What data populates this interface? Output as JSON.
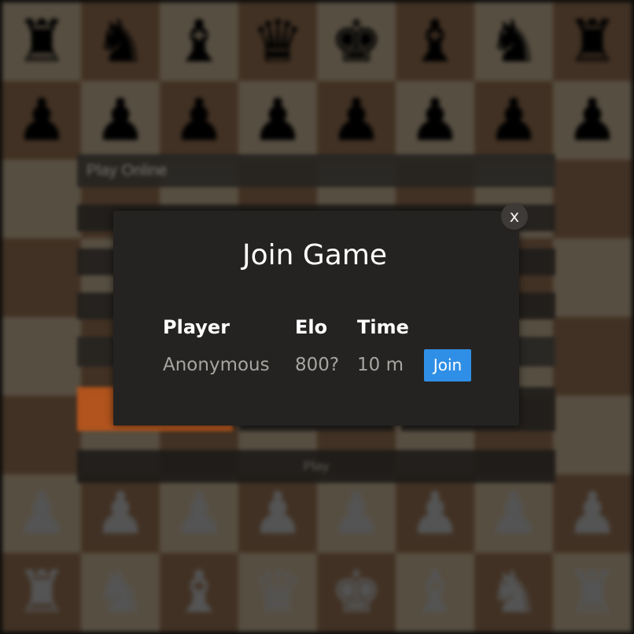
{
  "board": {
    "ranks": [
      [
        "br",
        "bn",
        "bb",
        "bq",
        "bk",
        "bb",
        "bn",
        "br"
      ],
      [
        "bp",
        "bp",
        "bp",
        "bp",
        "bp",
        "bp",
        "bp",
        "bp"
      ],
      [
        "",
        "",
        "",
        "",
        "",
        "",
        "",
        ""
      ],
      [
        "",
        "",
        "",
        "",
        "",
        "",
        "",
        ""
      ],
      [
        "",
        "",
        "",
        "",
        "",
        "",
        "",
        ""
      ],
      [
        "",
        "",
        "",
        "",
        "",
        "",
        "",
        ""
      ],
      [
        "wp",
        "wp",
        "wp",
        "wp",
        "wp",
        "wp",
        "wp",
        "wp"
      ],
      [
        "wr",
        "wn",
        "wb",
        "wq",
        "wk",
        "wb",
        "wn",
        "wr"
      ]
    ],
    "colors": {
      "light": "#f0d9b5",
      "dark": "#b58863"
    }
  },
  "background_panel": {
    "title": "Play Online",
    "play_label": "Play",
    "accent": "#b6551c"
  },
  "dialog": {
    "title": "Join Game",
    "close_label": "x",
    "columns": [
      "Player",
      "Elo",
      "Time"
    ],
    "games": [
      {
        "player": "Anonymous",
        "elo": "800?",
        "time": "10 m",
        "join_label": "Join"
      }
    ],
    "colors": {
      "background": "#252321",
      "join_button": "#2f8fe6",
      "close_button": "#3d3a37"
    }
  }
}
